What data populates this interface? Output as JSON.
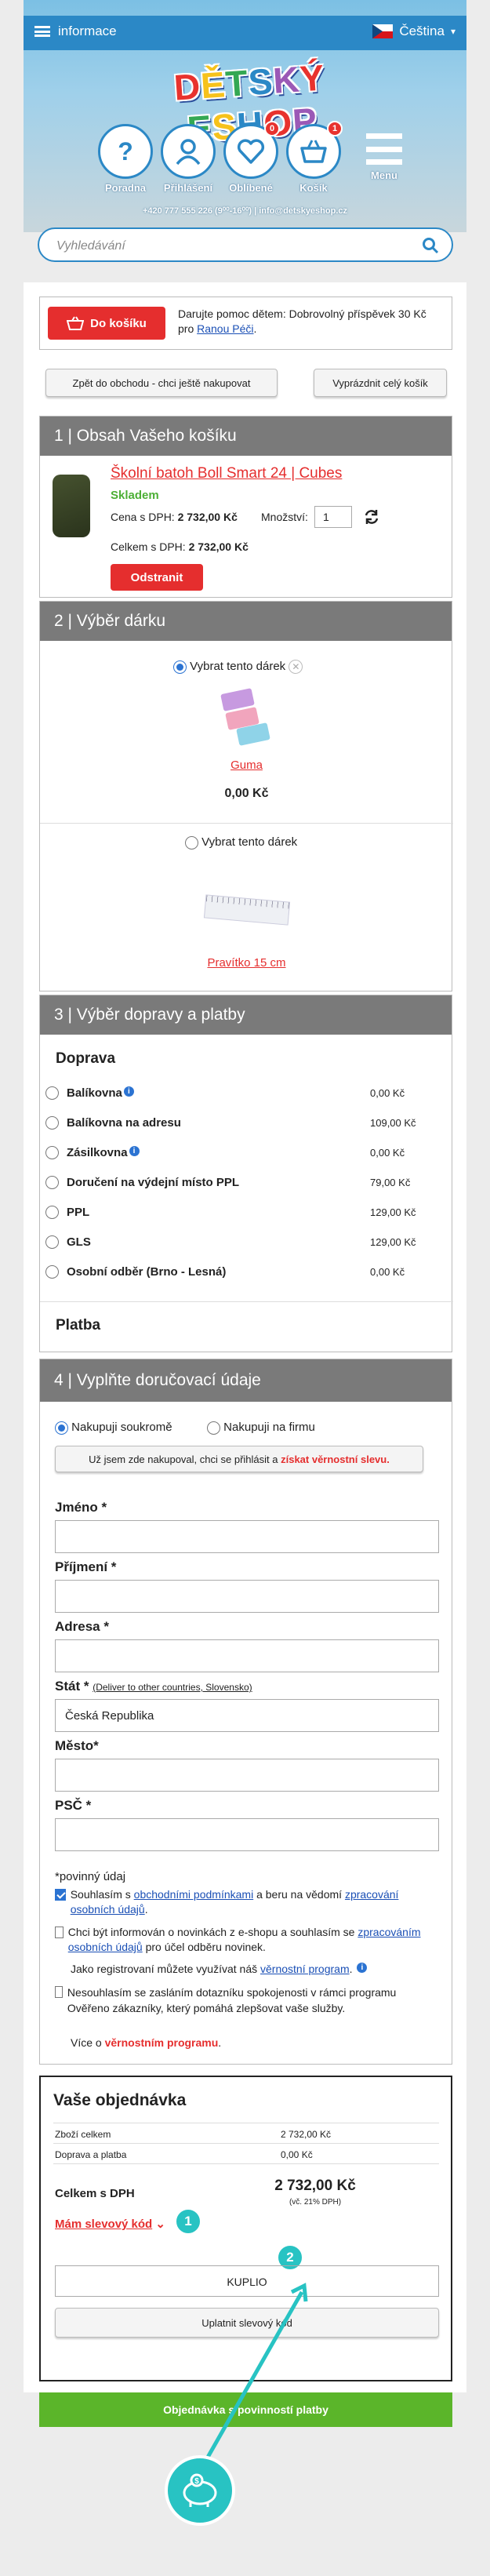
{
  "header": {
    "menu_label": "informace",
    "language": "Čeština",
    "logo_text": "DĚTSKÝ ESHOP",
    "nav": [
      {
        "label": "Poradna",
        "icon": "question-icon"
      },
      {
        "label": "Přihlášení",
        "icon": "user-icon"
      },
      {
        "label": "Oblíbené",
        "icon": "heart-icon",
        "badge": "0"
      },
      {
        "label": "Košík",
        "icon": "basket-icon",
        "badge": "1"
      },
      {
        "label": "Menu",
        "icon": "hamburger-icon"
      }
    ],
    "contact": "+420 777 555 226 (9⁰⁰-16⁰⁰) | info@detskyeshop.cz",
    "search_placeholder": "Vyhledávání"
  },
  "donate": {
    "button": "Do košíku",
    "text_pre": "Darujte pomoc dětem: Dobrovolný příspěvek 30 Kč pro ",
    "link": "Ranou Péči",
    "text_post": "."
  },
  "actions": {
    "back": "Zpět do obchodu - chci ještě nakupovat",
    "empty": "Vyprázdnit celý košík"
  },
  "section1": {
    "title": "1 | Obsah Vašeho košíku",
    "product_name": "Školní batoh Boll Smart 24 | Cubes",
    "stock": "Skladem",
    "price_label": "Cena s DPH:",
    "price": "2 732,00 Kč",
    "qty_label": "Množství:",
    "qty": "1",
    "total_label": "Celkem s DPH:",
    "total": "2 732,00 Kč",
    "remove": "Odstranit"
  },
  "section2": {
    "title": "2 | Výběr dárku",
    "gift1": {
      "choose": "Vybrat tento dárek",
      "name": "Guma",
      "price": "0,00 Kč"
    },
    "gift2": {
      "choose": "Vybrat tento dárek",
      "name": "Pravítko 15 cm"
    }
  },
  "section3": {
    "title": "3 | Výběr dopravy a platby",
    "shipping_heading": "Doprava",
    "shipping": [
      {
        "name": "Balíkovna",
        "price": "0,00 Kč",
        "info": true
      },
      {
        "name": "Balíkovna na adresu",
        "price": "109,00 Kč",
        "info": false
      },
      {
        "name": "Zásilkovna",
        "price": "0,00 Kč",
        "info": true
      },
      {
        "name": "Doručení na výdejní místo PPL",
        "price": "79,00 Kč",
        "info": false
      },
      {
        "name": "PPL",
        "price": "129,00 Kč",
        "info": false
      },
      {
        "name": "GLS",
        "price": "129,00 Kč",
        "info": false
      },
      {
        "name": "Osobní odběr (Brno - Lesná)",
        "price": "0,00 Kč",
        "info": false
      }
    ],
    "payment_heading": "Platba"
  },
  "section4": {
    "title": "4 | Vyplňte doručovací údaje",
    "private": "Nakupuji soukromě",
    "company": "Nakupuji na firmu",
    "login_pre": "Už jsem zde nakupoval, chci se přihlásit a ",
    "login_link": "získat věrnostní slevu.",
    "fields": {
      "name": "Jméno *",
      "surname": "Příjmení *",
      "address": "Adresa *",
      "state": "Stát *",
      "state_note": "(Deliver to other countries, Slovensko)",
      "state_value": "Česká Republika",
      "city": "Město*",
      "zip": "PSČ *"
    },
    "required": "*povinný údaj",
    "consent1_pre": "Souhlasím s ",
    "consent1_link1": "obchodními podmínkami",
    "consent1_mid": " a beru na vědomí ",
    "consent1_link2": "zpracování osobních údajů",
    "consent1_post": ".",
    "consent2_pre": "Chci být informován o novinkách z e-shopu a souhlasím se ",
    "consent2_link": "zpracováním osobních údajů",
    "consent2_post": " pro účel odběru novinek.",
    "loyalty_pre": "Jako registrovaní můžete využívat náš ",
    "loyalty_link": "věrnostní program",
    "loyalty_post": ".",
    "survey": "Nesouhlasím se zasláním dotazníku spokojenosti v rámci programu Ověřeno zákazníky, který pomáhá zlepšovat vaše služby.",
    "more_pre": "Více o ",
    "more_link": "věrnostním programu",
    "more_post": "."
  },
  "order": {
    "title": "Vaše objednávka",
    "goods_label": "Zboží celkem",
    "goods": "2 732,00 Kč",
    "ship_label": "Doprava a platba",
    "ship": "0,00 Kč",
    "total_label": "Celkem s DPH",
    "total": "2 732,00 Kč",
    "vat": "(vč. 21% DPH)",
    "discount_link": "Mám slevový kód",
    "code_value": "KUPLIO",
    "apply": "Uplatnit slevový kód",
    "step1": "1",
    "step2": "2",
    "submit": "Objednávka s povinností platby"
  },
  "colors": {
    "brand_blue": "#2b88c6",
    "red": "#e52e2e",
    "green": "#5bb52a",
    "teal": "#28c3c3"
  }
}
